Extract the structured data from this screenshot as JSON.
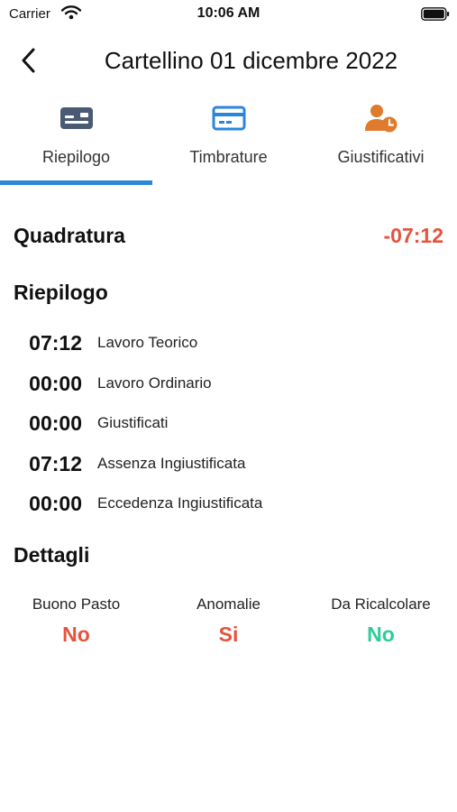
{
  "status": {
    "carrier": "Carrier",
    "time": "10:06 AM"
  },
  "nav": {
    "title": "Cartellino 01 dicembre 2022",
    "back_icon": "chevron-left-icon"
  },
  "tabs": [
    {
      "label": "Riepilogo",
      "icon": "id-card-icon",
      "color": "#4a5a73",
      "selected": true
    },
    {
      "label": "Timbrature",
      "icon": "credit-card-icon",
      "color": "#2b86d9",
      "selected": false
    },
    {
      "label": "Giustificativi",
      "icon": "person-clock-icon",
      "color": "#e07a2c",
      "selected": false
    }
  ],
  "quadratura": {
    "label": "Quadratura",
    "value": "-07:12",
    "color": "#e5533d"
  },
  "riepilogo": {
    "title": "Riepilogo",
    "rows": [
      {
        "time": "07:12",
        "label": "Lavoro Teorico"
      },
      {
        "time": "00:00",
        "label": "Lavoro Ordinario"
      },
      {
        "time": "00:00",
        "label": "Giustificati"
      },
      {
        "time": "07:12",
        "label": "Assenza Ingiustificata"
      },
      {
        "time": "00:00",
        "label": "Eccedenza Ingiustificata"
      }
    ]
  },
  "dettagli": {
    "title": "Dettagli",
    "items": [
      {
        "label": "Buono Pasto",
        "value": "No",
        "color": "#e5533d"
      },
      {
        "label": "Anomalie",
        "value": "Si",
        "color": "#e5533d"
      },
      {
        "label": "Da Ricalcolare",
        "value": "No",
        "color": "#2ecc9a"
      }
    ]
  },
  "accent_color": "#2b86d9"
}
